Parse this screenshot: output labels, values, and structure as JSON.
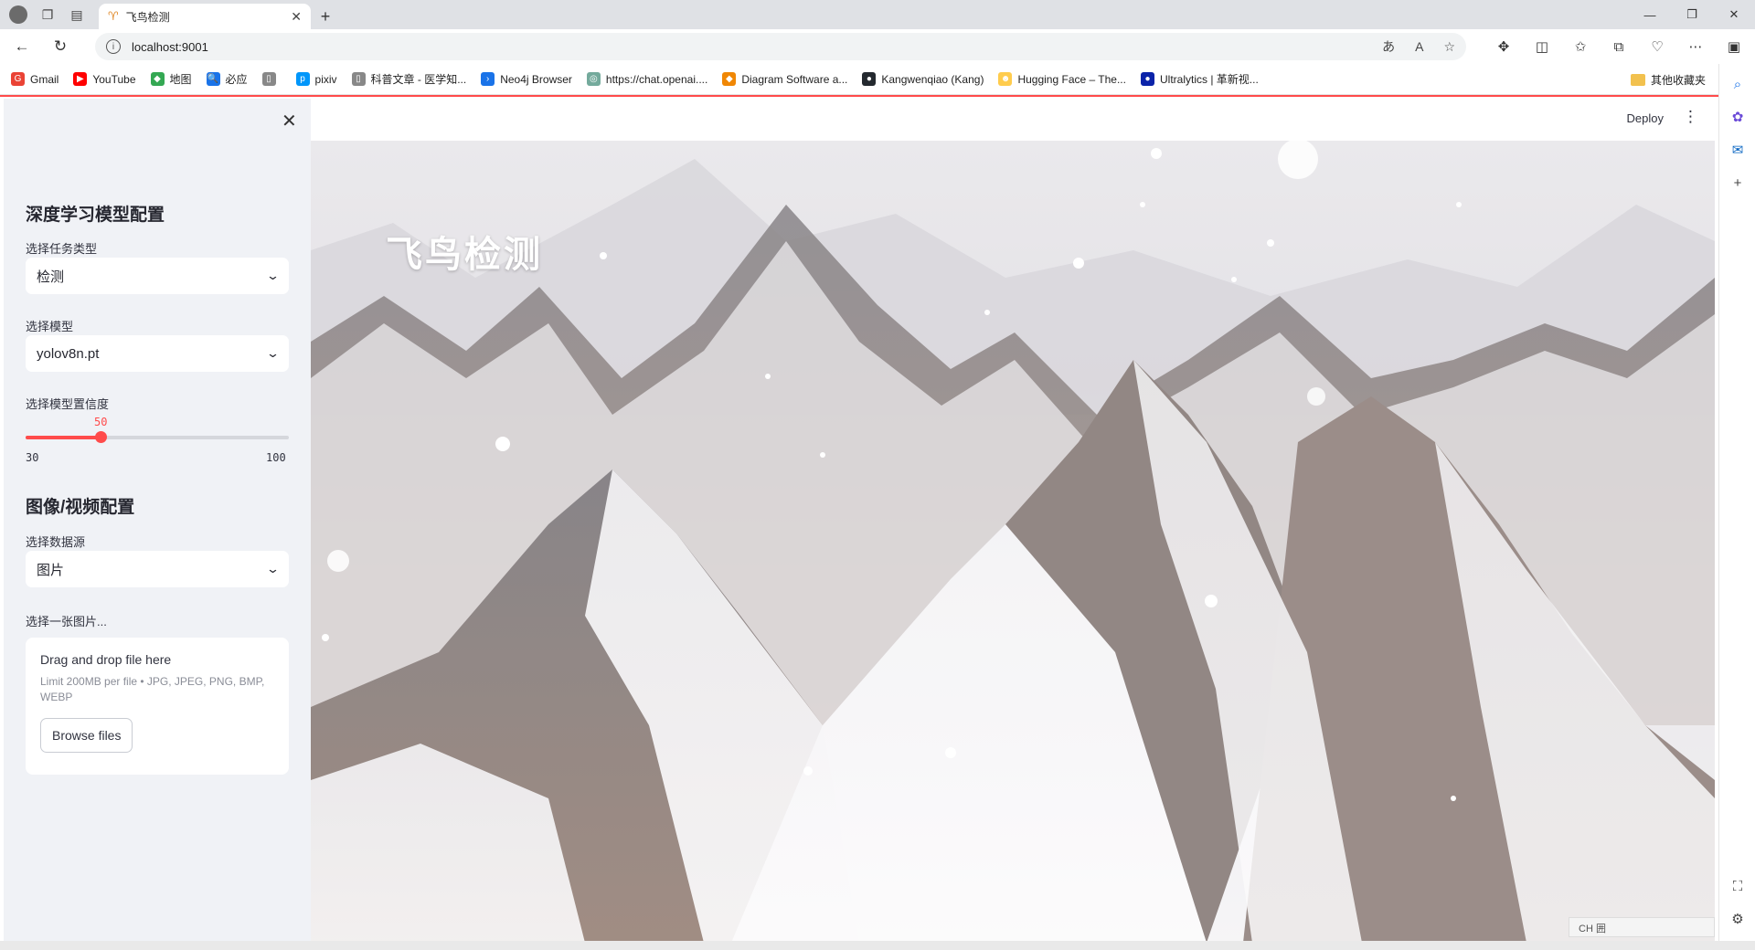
{
  "browser": {
    "tab_title": "飞鸟检测",
    "address": "localhost:9001",
    "bookmarks": [
      {
        "label": "Gmail",
        "color": "#ea4335",
        "glyph": "G"
      },
      {
        "label": "YouTube",
        "color": "#ff0000",
        "glyph": "▶"
      },
      {
        "label": "地图",
        "color": "#34a853",
        "glyph": "◆"
      },
      {
        "label": "必应",
        "color": "#1a73e8",
        "glyph": "🔍"
      },
      {
        "label": "",
        "color": "#888888",
        "glyph": "▯"
      },
      {
        "label": "pixiv",
        "color": "#0096fa",
        "glyph": "p"
      },
      {
        "label": "科普文章 - 医学知...",
        "color": "#888888",
        "glyph": "▯"
      },
      {
        "label": "Neo4j Browser",
        "color": "#1a73e8",
        "glyph": "›"
      },
      {
        "label": "https://chat.openai....",
        "color": "#74aa9c",
        "glyph": "◎"
      },
      {
        "label": "Diagram Software a...",
        "color": "#f08705",
        "glyph": "◆"
      },
      {
        "label": "Kangwenqiao (Kang)",
        "color": "#24292f",
        "glyph": "●"
      },
      {
        "label": "Hugging Face – The...",
        "color": "#ffcc4d",
        "glyph": "☻"
      },
      {
        "label": "Ultralytics | 革新视...",
        "color": "#0b23a9",
        "glyph": "●"
      }
    ],
    "other_bookmarks": "其他收藏夹"
  },
  "sidebar": {
    "model_section_title": "深度学习模型配置",
    "task_label": "选择任务类型",
    "task_value": "检测",
    "model_label": "选择模型",
    "model_value": "yolov8n.pt",
    "confidence_label": "选择模型置信度",
    "confidence": {
      "value": "50",
      "min": "30",
      "max": "100"
    },
    "media_section_title": "图像/视频配置",
    "source_label": "选择数据源",
    "source_value": "图片",
    "file_label": "选择一张图片...",
    "uploader": {
      "main": "Drag and drop file here",
      "sub": "Limit 200MB per file • JPG, JPEG, PNG, BMP, WEBP",
      "button": "Browse files"
    }
  },
  "header": {
    "deploy": "Deploy"
  },
  "main": {
    "title": "飞鸟检测"
  },
  "status": {
    "text": "CH 囲"
  },
  "colors": {
    "accent": "#ff4b4b",
    "sidebar_bg": "#f0f2f6"
  }
}
